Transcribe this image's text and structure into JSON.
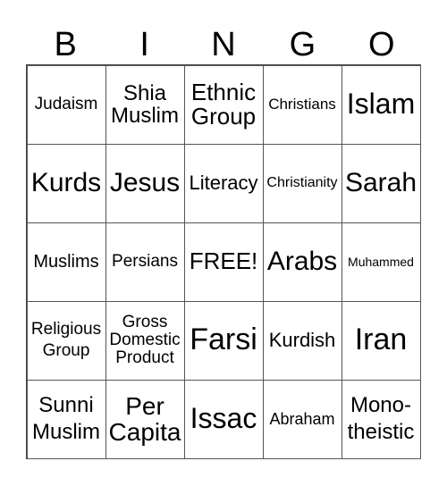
{
  "header": [
    "B",
    "I",
    "N",
    "G",
    "O"
  ],
  "cells": [
    "Judaism",
    "Shia\nMuslim",
    "Ethnic\nGroup",
    "Christians",
    "Islam",
    "Kurds",
    "Jesus",
    "Literacy",
    "Christianity",
    "Sarah",
    "Muslims",
    "Persians",
    "FREE!",
    "Arabs",
    "Muhammed",
    "Religious\nGroup",
    "Gross\nDomestic\nProduct",
    "Farsi",
    "Kurdish",
    "Iran",
    "Sunni\nMuslim",
    "Per\nCapita",
    "Issac",
    "Abraham",
    "Mono-\ntheistic"
  ]
}
